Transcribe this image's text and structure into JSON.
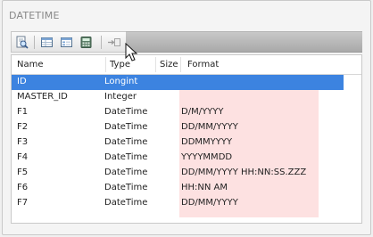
{
  "panel": {
    "title": "DATETIME"
  },
  "toolbar": {
    "buttons": [
      {
        "icon": "preview-icon"
      },
      {
        "icon": "table-icon"
      },
      {
        "icon": "form-icon"
      },
      {
        "icon": "calculator-icon"
      },
      {
        "icon": "export-arrow-icon"
      }
    ]
  },
  "grid": {
    "columns": [
      "Name",
      "Type",
      "Size",
      "Format"
    ],
    "rows": [
      {
        "name": "ID",
        "type": "Longint",
        "size": "",
        "format": "",
        "selected": true
      },
      {
        "name": "MASTER_ID",
        "type": "Integer",
        "size": "",
        "format": ""
      },
      {
        "name": "F1",
        "type": "DateTime",
        "size": "",
        "format": "D/M/YYYY"
      },
      {
        "name": "F2",
        "type": "DateTime",
        "size": "",
        "format": "DD/MM/YYYY"
      },
      {
        "name": "F3",
        "type": "DateTime",
        "size": "",
        "format": "DDMMYYYY"
      },
      {
        "name": "F4",
        "type": "DateTime",
        "size": "",
        "format": "YYYYMMDD"
      },
      {
        "name": "F5",
        "type": "DateTime",
        "size": "",
        "format": "DD/MM/YYYY HH:NN:SS.ZZZ"
      },
      {
        "name": "F6",
        "type": "DateTime",
        "size": "",
        "format": "HH:NN AM"
      },
      {
        "name": "F7",
        "type": "DateTime",
        "size": "",
        "format": "DD/MM/YYYY"
      }
    ]
  },
  "colors": {
    "selection": "#3c83e0",
    "format_highlight": "#fde1e1"
  }
}
